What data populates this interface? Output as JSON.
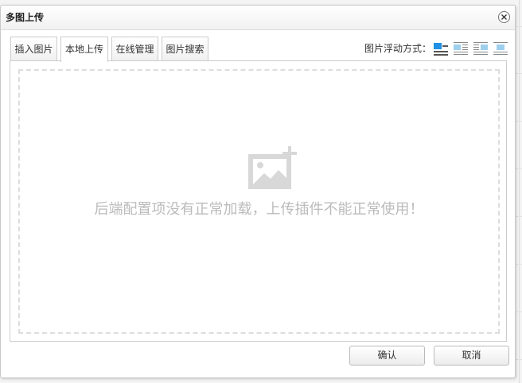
{
  "dialog": {
    "title": "多图上传"
  },
  "tabs": [
    {
      "label": "插入图片",
      "active": false
    },
    {
      "label": "本地上传",
      "active": true
    },
    {
      "label": "在线管理",
      "active": false
    },
    {
      "label": "图片搜索",
      "active": false
    }
  ],
  "float_mode": {
    "label": "图片浮动方式：",
    "options": [
      "none-icon",
      "left-icon",
      "right-icon",
      "center-icon"
    ],
    "selected": "none-icon"
  },
  "upload": {
    "placeholder_icon": "image-add-icon",
    "error_message": "后端配置项没有正常加载，上传插件不能正常使用！"
  },
  "buttons": {
    "confirm": "确认",
    "cancel": "取消"
  },
  "colors": {
    "float_accent": "#1e90e6",
    "float_lines": "#555555",
    "placeholder_icon": "#d8d8d8",
    "error_text": "#bbbbbb"
  }
}
